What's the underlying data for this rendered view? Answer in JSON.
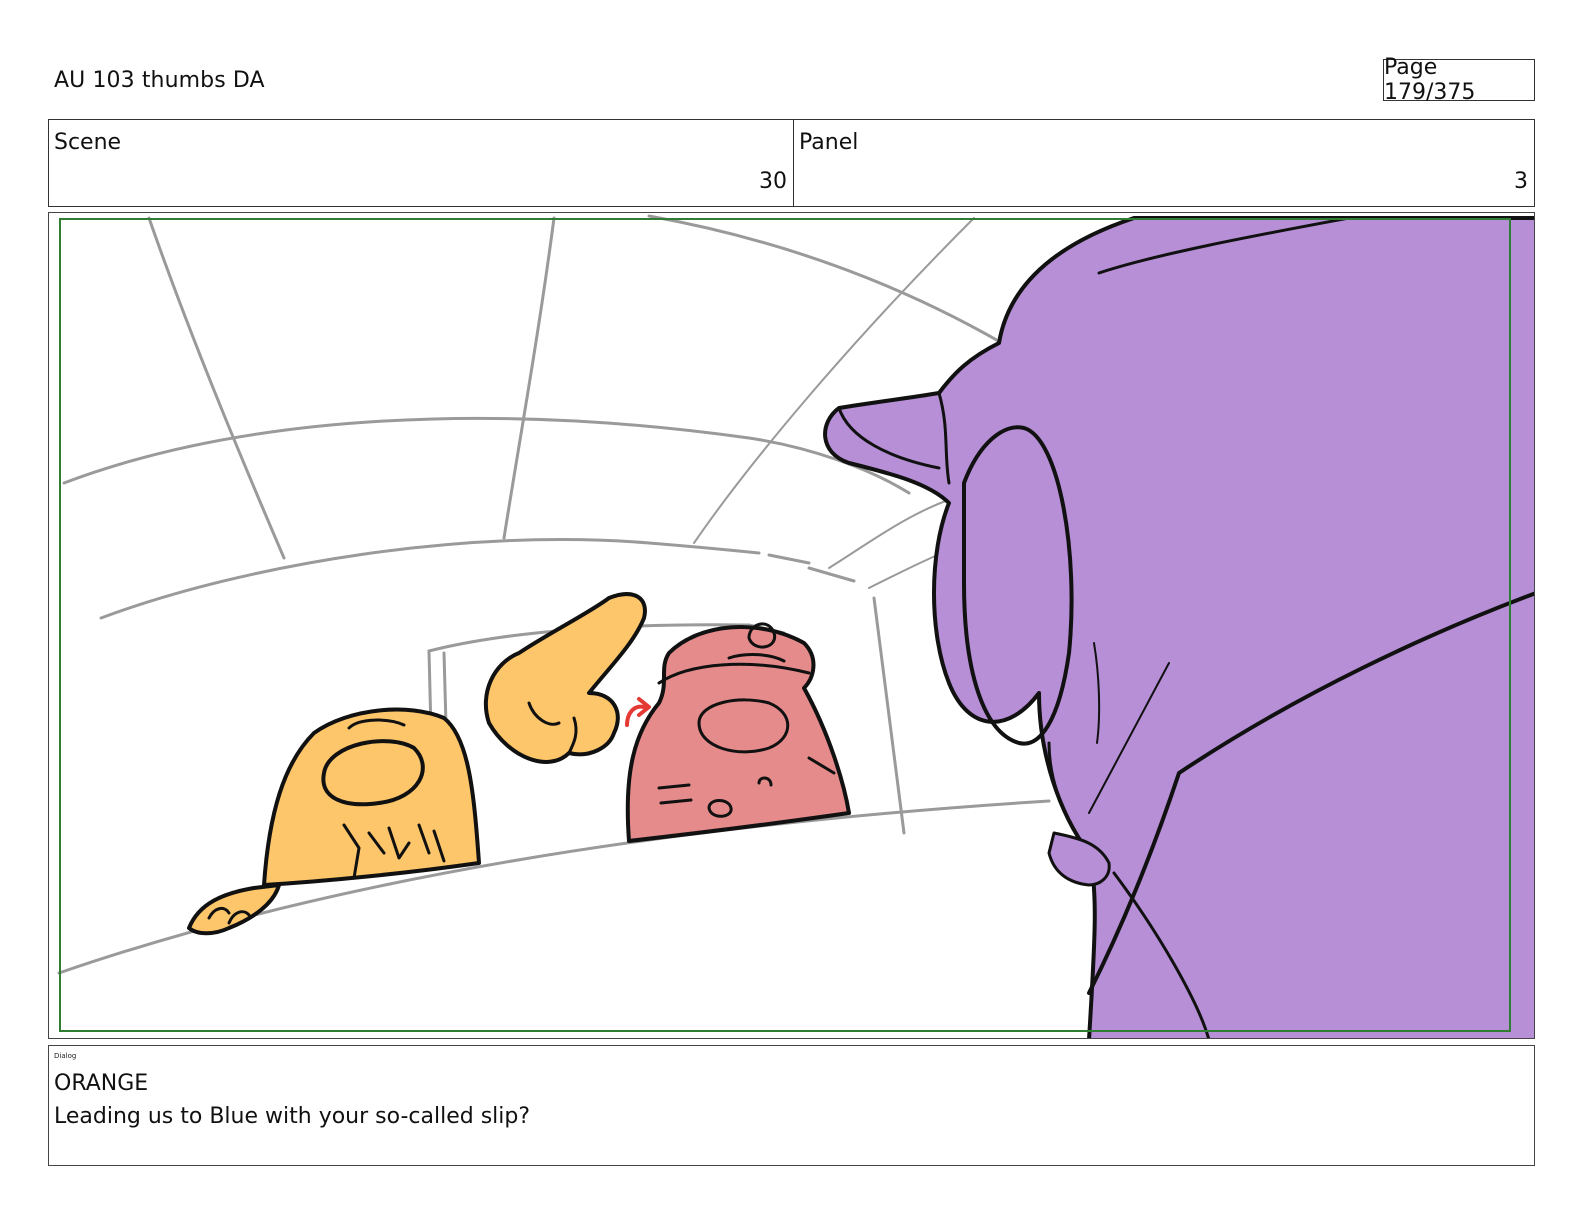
{
  "document": {
    "title": "AU 103 thumbs DA",
    "page_label": "Page 179/375"
  },
  "header": {
    "scene_label": "Scene",
    "scene_value": "30",
    "panel_label": "Panel",
    "panel_value": "3"
  },
  "dialog": {
    "tag": "Dialog",
    "character": "ORANGE",
    "line": "Leading us to Blue with your so-called slip?"
  },
  "colors": {
    "safe_frame": "#2e7d32",
    "orange_character": "#fdc66a",
    "red_character": "#e58b8b",
    "purple_character": "#b68fd6",
    "background_lines": "#9a9a9a",
    "action_arrow": "#e53935",
    "ink": "#111111"
  }
}
